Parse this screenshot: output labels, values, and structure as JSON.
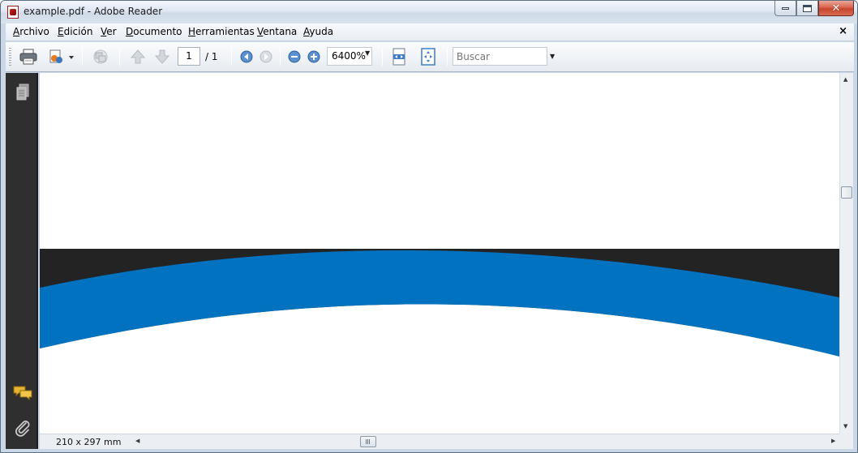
{
  "window": {
    "title": "example.pdf - Adobe Reader",
    "close_glyph": "✕"
  },
  "menu": {
    "items": [
      {
        "accel": "A",
        "rest": "rchivo"
      },
      {
        "accel": "E",
        "rest": "dición"
      },
      {
        "accel": "V",
        "rest": "er"
      },
      {
        "accel": "D",
        "rest": "ocumento"
      },
      {
        "accel": "H",
        "rest": "erramientas"
      },
      {
        "accel": "V",
        "rest": "entana"
      },
      {
        "accel": "A",
        "rest": "yuda"
      }
    ],
    "close_glyph": "×"
  },
  "toolbar": {
    "page_current": "1",
    "page_total": "/ 1",
    "zoom": "6400%",
    "search_placeholder": "Buscar",
    "icons": [
      "print-icon",
      "share-icon",
      "collaborate-icon",
      "previous-page-icon",
      "next-page-icon",
      "back-view-icon",
      "forward-view-icon",
      "zoom-out-icon",
      "zoom-in-icon",
      "fit-width-icon",
      "fit-page-icon"
    ]
  },
  "leftpane": {
    "icons": [
      "pages-icon",
      "comments-icon",
      "attachments-icon"
    ]
  },
  "document": {
    "colors": {
      "dark_band": "#232323",
      "blue_band": "#0072c0",
      "page": "#ffffff"
    }
  },
  "status": {
    "page_size": "210 x 297 mm"
  },
  "colors": {
    "frame": "#c9d7e6",
    "left_pane": "#2f2f2f",
    "accent_blue": "#0072c0"
  }
}
